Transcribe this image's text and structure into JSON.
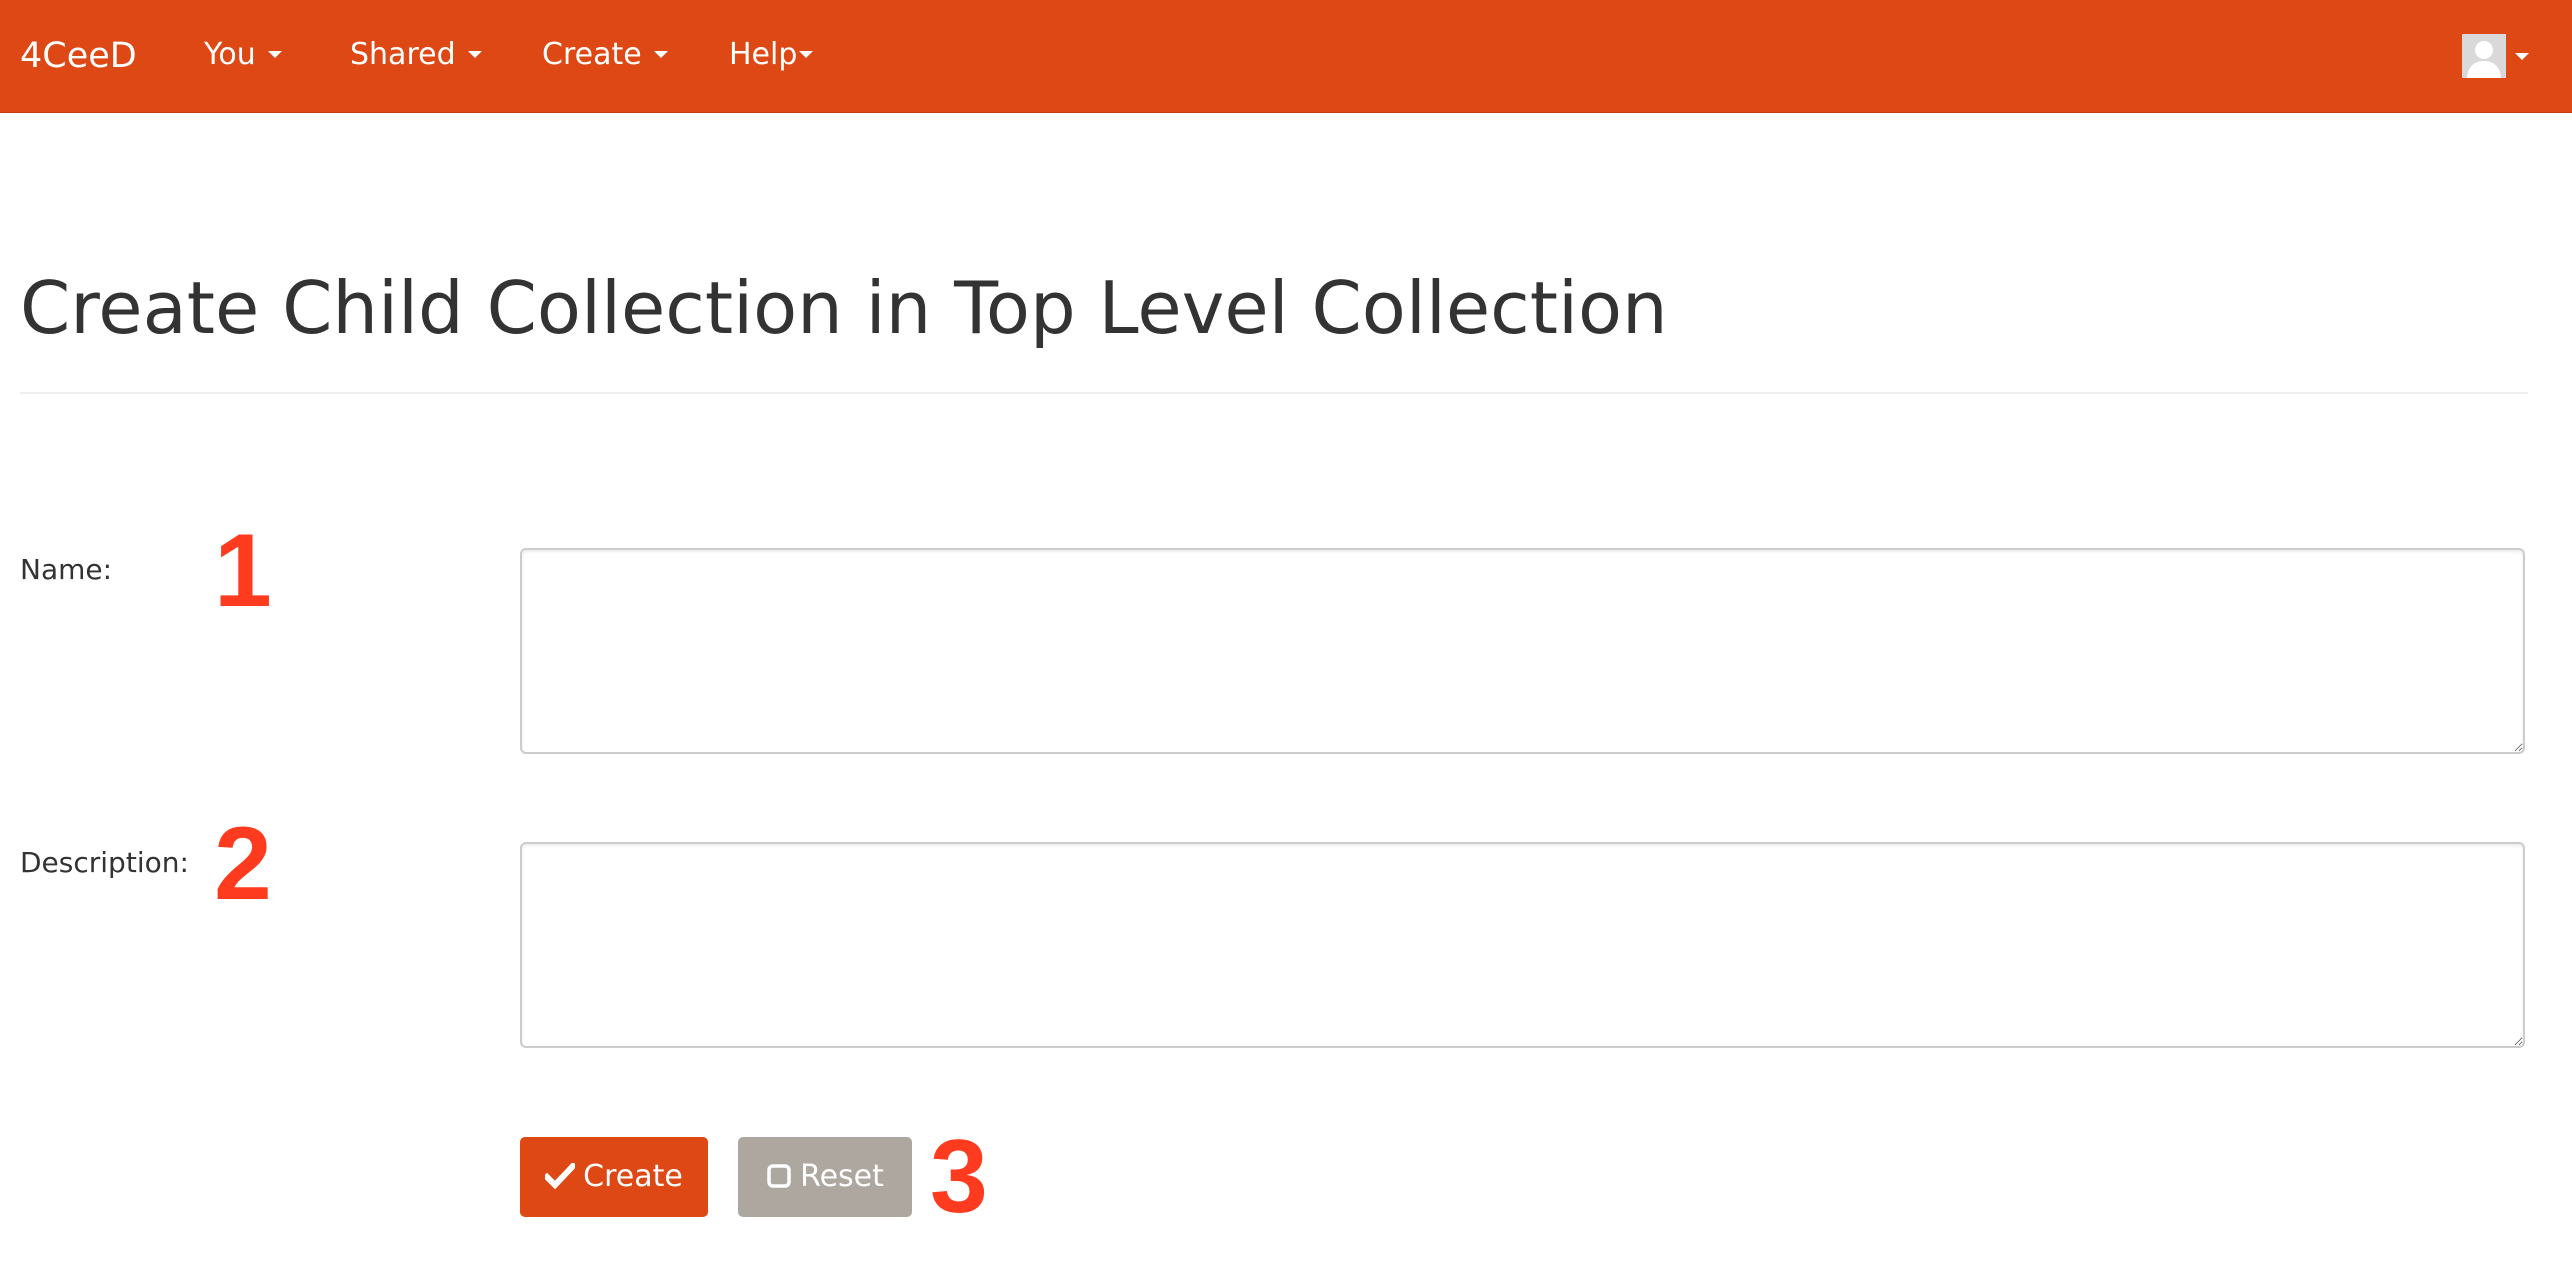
{
  "navbar": {
    "brand": "4CeeD",
    "items": [
      {
        "label": "You"
      },
      {
        "label": "Shared"
      },
      {
        "label": "Create"
      },
      {
        "label": "Help"
      }
    ]
  },
  "page": {
    "title": "Create Child Collection in Top Level Collection"
  },
  "form": {
    "name_label": "Name:",
    "name_value": "",
    "description_label": "Description:",
    "description_value": "",
    "create_label": "Create",
    "reset_label": "Reset"
  },
  "annotations": [
    "1",
    "2",
    "3"
  ],
  "colors": {
    "navbar": "#dd4814",
    "create_button": "#dd4814",
    "reset_button": "#aea79f",
    "annotation": "#ff3b1f"
  }
}
